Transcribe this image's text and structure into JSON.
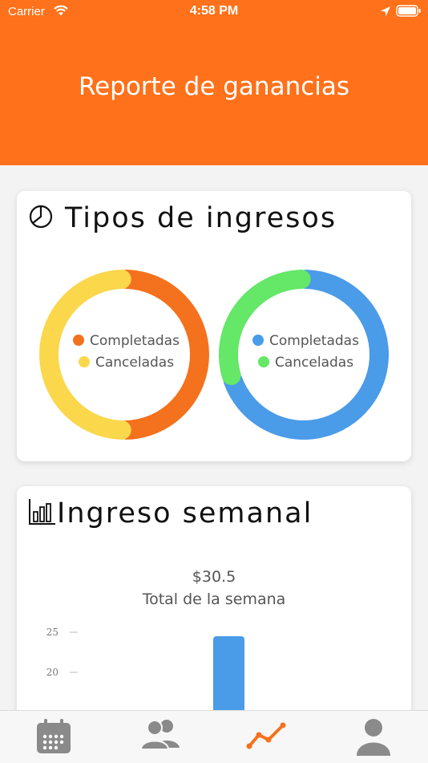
{
  "status_bar": {
    "carrier": "Carrier",
    "time": "4:58 PM"
  },
  "header": {
    "title": "Reporte de ganancias"
  },
  "income_types": {
    "title": "Tipos de ingresos",
    "icon": "pie-chart-icon",
    "charts": [
      {
        "legend": [
          "Completadas",
          "Canceladas"
        ],
        "colors": [
          "#f4711d",
          "#fbd74c"
        ],
        "values": [
          50,
          50
        ]
      },
      {
        "legend": [
          "Completadas",
          "Canceladas"
        ],
        "colors": [
          "#4a9be8",
          "#65e768"
        ],
        "values": [
          70,
          30
        ]
      }
    ]
  },
  "weekly_income": {
    "title": "Ingreso semanal",
    "icon": "bar-chart-icon",
    "total_value": "$30.5",
    "total_label": "Total de la semana"
  },
  "chart_data": {
    "type": "bar",
    "title": "",
    "xlabel": "",
    "ylabel": "",
    "y_ticks": [
      20,
      25
    ],
    "values": [
      24.5
    ],
    "color": "#4a9be8"
  },
  "tabbar": {
    "items": [
      {
        "name": "calendar-icon",
        "active": false
      },
      {
        "name": "users-icon",
        "active": false
      },
      {
        "name": "trend-icon",
        "active": true
      },
      {
        "name": "profile-icon",
        "active": false
      }
    ],
    "active_color": "#f4711d",
    "inactive_color": "#8a8a8a"
  }
}
